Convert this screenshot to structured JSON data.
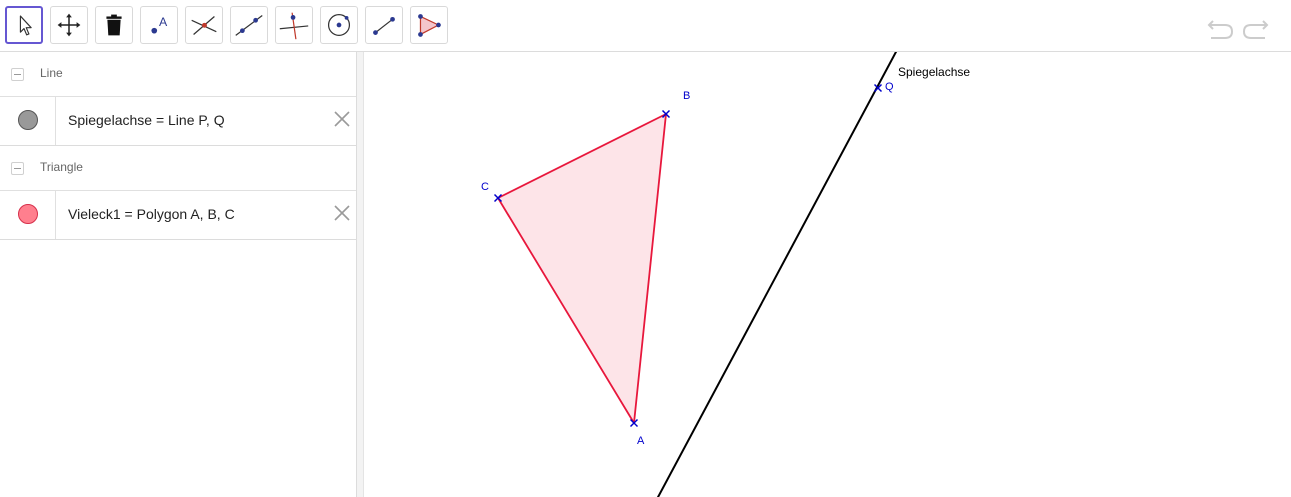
{
  "toolbar": {
    "tools": [
      {
        "name": "move-tool",
        "selected": true
      },
      {
        "name": "move-graphics-view-tool"
      },
      {
        "name": "delete-tool"
      },
      {
        "name": "point-tool",
        "icon_label": "A"
      },
      {
        "name": "intersect-tool"
      },
      {
        "name": "line-tool"
      },
      {
        "name": "perpendicular-line-tool"
      },
      {
        "name": "circle-with-center-tool"
      },
      {
        "name": "segment-tool"
      },
      {
        "name": "polygon-tool"
      }
    ]
  },
  "algebra": {
    "groups": [
      {
        "label": "Line",
        "items": [
          {
            "text": "Spiegelachse = Line P, Q",
            "color": "#999999"
          }
        ]
      },
      {
        "label": "Triangle",
        "items": [
          {
            "text": "Vieleck1 = Polygon A, B, C",
            "color": "#ff7f8e"
          }
        ]
      }
    ]
  },
  "graphics": {
    "colors": {
      "point": "#0000cc",
      "polygon_stroke": "#e8173c",
      "polygon_fill": "#fde4e8",
      "line": "#000000"
    },
    "points": {
      "A": "A",
      "B": "B",
      "C": "C",
      "Q": "Q"
    },
    "line_label": "Spiegelachse"
  }
}
